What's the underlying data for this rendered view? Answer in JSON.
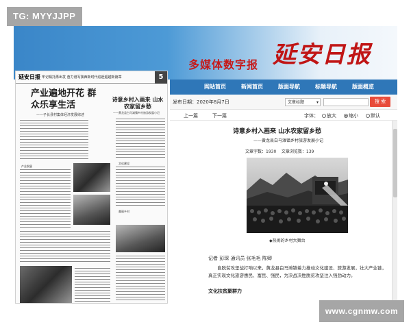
{
  "watermarks": {
    "top": "TG: MYYJJPP",
    "bottom": "www.cgnmw.com"
  },
  "banner": {
    "title": "多媒体数字报",
    "logo": "延安日报"
  },
  "nav": {
    "items": [
      "网站首页",
      "新闻首页",
      "版面导航",
      "标题导航",
      "版面概览"
    ]
  },
  "newspaper": {
    "masthead": "延安日报",
    "strap": "牢记嘱托再出发 奋力谱写陕西新时代追赶超越新篇章",
    "page_number": "5",
    "headline_main": "产业遍地开花 群众乐享生活",
    "subhead_main": "——子长县村集体经济发展综述",
    "headline_side": "诗意乡村入画来 山水农家留乡愁",
    "subhead_side": "——黄龙县白马滩镇乡村旅游发展小记",
    "tags": [
      "产业发展",
      "文化建设",
      "美丽乡村"
    ]
  },
  "toolbar": {
    "pub_date": "发布日期：2020年8月7日",
    "select_value": "文章标题",
    "search_button": "搜 索"
  },
  "pager": {
    "prev": "上一篇",
    "next": "下一篇",
    "fontsize_label": "字体：",
    "options": [
      "放大",
      "缩小",
      "默认"
    ]
  },
  "article": {
    "title": "诗意乡村入画来 山水农家留乡愁",
    "subtitle": "——黄龙县白马滩镇乡村旅游发展小记",
    "word_count": "文章字数：1930",
    "view_count": "文章浏览数：139",
    "caption": "◆热闹的乡村大舞台",
    "byline": "记者 彭琛  通讯员 张毛毛  陈卿",
    "paragraph": "自脱贫攻坚战打响以来，黄龙县白马滩镇着力推动文化建设、旅游发展，壮大产业链，真正实现文化旅游惠民、富民、强民，为决战决胜脱贫攻坚注入强劲动力。",
    "section": "文化扶贫聚群力"
  }
}
